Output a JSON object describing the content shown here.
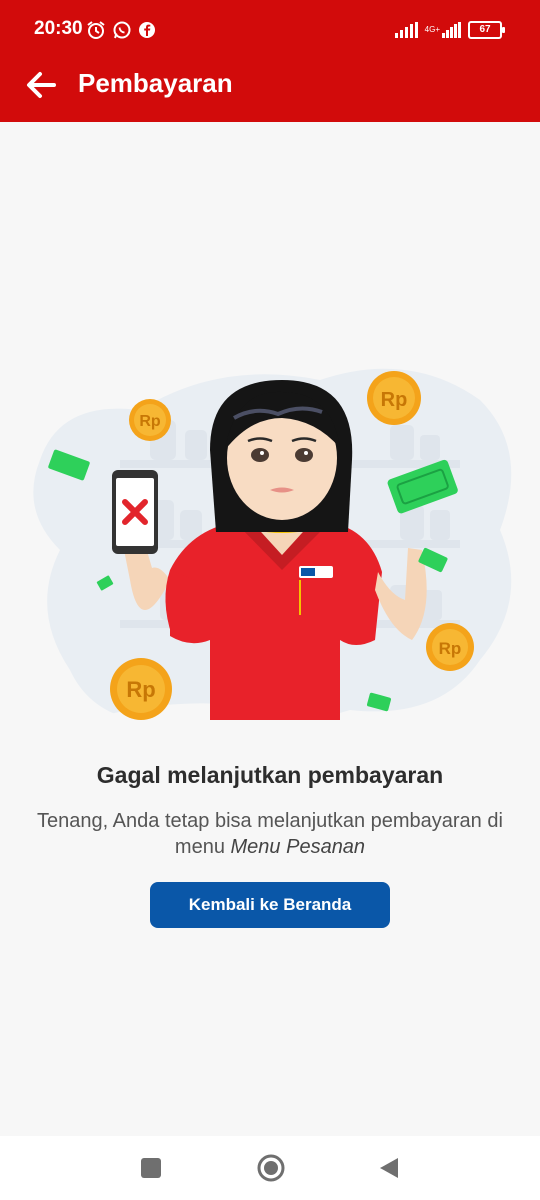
{
  "status_bar": {
    "time": "20:30",
    "network": "4G+",
    "battery": "67"
  },
  "app_bar": {
    "title": "Pembayaran",
    "back_icon": "arrow-left-icon"
  },
  "illustration": {
    "name": "payment-failed-illustration",
    "name_tag": "Alfamart"
  },
  "message": {
    "headline": "Gagal melanjutkan pembayaran",
    "body_prefix": "Tenang, Anda tetap bisa melanjutkan pembayaran di menu",
    "body_emphasis": "Menu Pesanan"
  },
  "actions": {
    "home_button_label": "Kembali ke Beranda"
  },
  "nav_bar": {
    "recents_icon": "square-icon",
    "home_icon": "circle-home-icon",
    "back_icon": "triangle-back-icon"
  },
  "colors": {
    "header": "#d20b0b",
    "primary_button": "#0a57a8",
    "background": "#f7f7f7"
  }
}
